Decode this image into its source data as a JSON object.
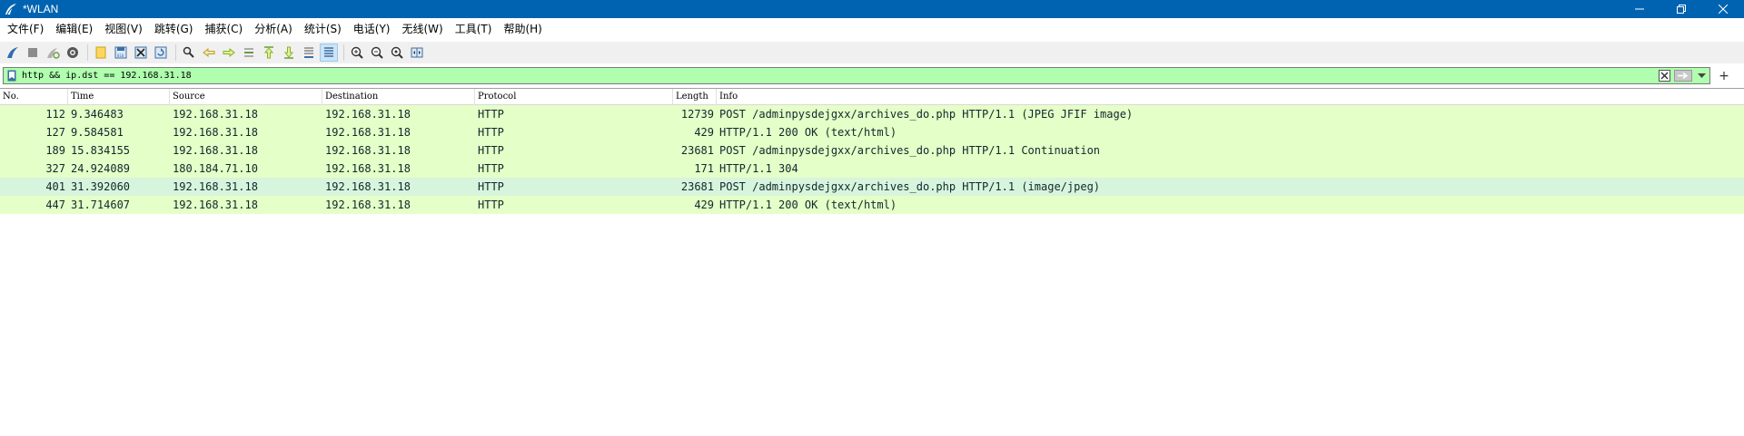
{
  "window": {
    "title": "*WLAN",
    "controls": {
      "minimize": "—",
      "restore": "❐",
      "close": "✕"
    }
  },
  "menu": [
    "文件(F)",
    "编辑(E)",
    "视图(V)",
    "跳转(G)",
    "捕获(C)",
    "分析(A)",
    "统计(S)",
    "电话(Y)",
    "无线(W)",
    "工具(T)",
    "帮助(H)"
  ],
  "toolbar": {
    "icons": [
      "shark-fin-start-icon",
      "stop-square-icon",
      "restart-fin-icon",
      "capture-options-icon",
      "open-file-icon",
      "save-file-icon",
      "close-file-icon",
      "reload-icon",
      "find-packet-icon",
      "go-back-icon",
      "go-forward-icon",
      "go-to-packet-icon",
      "go-first-icon",
      "go-last-icon",
      "auto-scroll-icon",
      "colorize-icon",
      "zoom-in-icon",
      "zoom-out-icon",
      "zoom-normal-icon",
      "resize-columns-icon"
    ]
  },
  "filter": {
    "value": "http && ip.dst == 192.168.31.18",
    "add_label": "+",
    "bg_color": "#afffaf"
  },
  "columns": [
    "No.",
    "Time",
    "Source",
    "Destination",
    "Protocol",
    "Length",
    "Info"
  ],
  "packets": [
    {
      "no": "112",
      "time": "9.346483",
      "src": "192.168.31.18",
      "dst": "192.168.31.18",
      "proto": "HTTP",
      "len": "12739",
      "info": "POST /adminpysdejgxx/archives_do.php HTTP/1.1  (JPEG JFIF image)"
    },
    {
      "no": "127",
      "time": "9.584581",
      "src": "192.168.31.18",
      "dst": "192.168.31.18",
      "proto": "HTTP",
      "len": "429",
      "info": "HTTP/1.1 200 OK  (text/html)"
    },
    {
      "no": "189",
      "time": "15.834155",
      "src": "192.168.31.18",
      "dst": "192.168.31.18",
      "proto": "HTTP",
      "len": "23681",
      "info": "POST /adminpysdejgxx/archives_do.php HTTP/1.1 Continuation"
    },
    {
      "no": "327",
      "time": "24.924089",
      "src": "180.184.71.10",
      "dst": "192.168.31.18",
      "proto": "HTTP",
      "len": "171",
      "info": "HTTP/1.1 304"
    },
    {
      "no": "401",
      "time": "31.392060",
      "src": "192.168.31.18",
      "dst": "192.168.31.18",
      "proto": "HTTP",
      "len": "23681",
      "info": "POST /adminpysdejgxx/archives_do.php HTTP/1.1  (image/jpeg)"
    },
    {
      "no": "447",
      "time": "31.714607",
      "src": "192.168.31.18",
      "dst": "192.168.31.18",
      "proto": "HTTP",
      "len": "429",
      "info": "HTTP/1.1 200 OK  (text/html)"
    }
  ],
  "colors": {
    "titlebar": "#0063b1",
    "row_http": "#e4ffc7",
    "row_alt": "#d7f5dc"
  }
}
